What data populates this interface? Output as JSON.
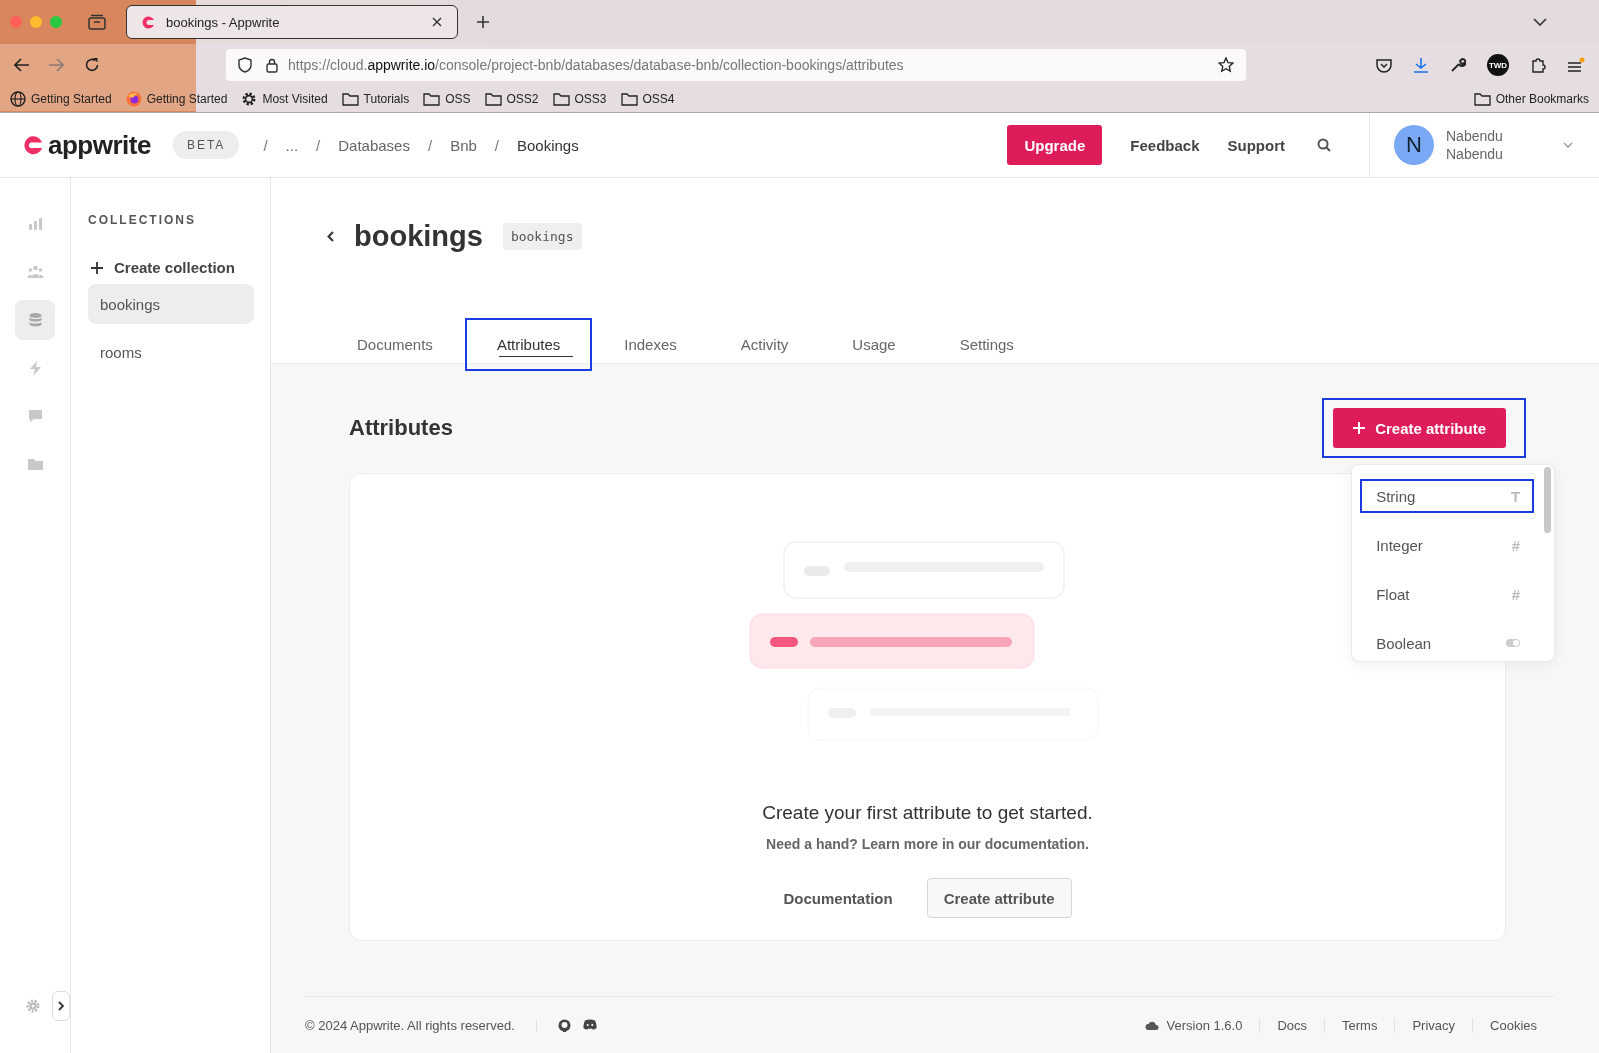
{
  "browser": {
    "tab_title": "bookings - Appwrite",
    "url_prefix": "https://cloud.",
    "url_domain": "appwrite.io",
    "url_path": "/console/project-bnb/databases/database-bnb/collection-bookings/attributes",
    "bookmarks": [
      {
        "label": "Getting Started",
        "kind": "globe"
      },
      {
        "label": "Getting Started",
        "kind": "firefox"
      },
      {
        "label": "Most Visited",
        "kind": "gear"
      },
      {
        "label": "Tutorials",
        "kind": "folder"
      },
      {
        "label": "OSS",
        "kind": "folder"
      },
      {
        "label": "OSS2",
        "kind": "folder"
      },
      {
        "label": "OSS3",
        "kind": "folder"
      },
      {
        "label": "OSS4",
        "kind": "folder"
      }
    ],
    "other_bookmarks": "Other Bookmarks",
    "avatar_text": "TWD"
  },
  "header": {
    "logo": "appwrite",
    "badge": "BETA",
    "separator": "/",
    "breadcrumbs": [
      "...",
      "Databases",
      "Bnb",
      "Bookings"
    ],
    "upgrade": "Upgrade",
    "links": [
      "Feedback",
      "Support"
    ],
    "user": {
      "initial": "N",
      "name": "Nabendu",
      "org": "Nabendu"
    }
  },
  "rail": [
    {
      "kind": "chart",
      "selected": false
    },
    {
      "kind": "people",
      "selected": false
    },
    {
      "kind": "database",
      "selected": true
    },
    {
      "kind": "bolt",
      "selected": false
    },
    {
      "kind": "chat",
      "selected": false
    },
    {
      "kind": "folder",
      "selected": false
    }
  ],
  "collections": {
    "heading": "COLLECTIONS",
    "create": "Create collection",
    "items": [
      {
        "label": "bookings",
        "selected": true
      },
      {
        "label": "rooms",
        "selected": false
      }
    ]
  },
  "page": {
    "title": "bookings",
    "id_badge": "bookings",
    "tabs": [
      {
        "label": "Documents",
        "selected": false,
        "highlighted": false
      },
      {
        "label": "Attributes",
        "selected": true,
        "highlighted": true
      },
      {
        "label": "Indexes",
        "selected": false,
        "highlighted": false
      },
      {
        "label": "Activity",
        "selected": false,
        "highlighted": false
      },
      {
        "label": "Usage",
        "selected": false,
        "highlighted": false
      },
      {
        "label": "Settings",
        "selected": false,
        "highlighted": false
      }
    ],
    "section_title": "Attributes",
    "create_button": {
      "label": "Create attribute",
      "highlighted": true
    },
    "menu": [
      {
        "label": "String",
        "kind": "text",
        "symbol": "T",
        "highlighted": true
      },
      {
        "label": "Integer",
        "kind": "text",
        "symbol": "#",
        "highlighted": false
      },
      {
        "label": "Float",
        "kind": "text",
        "symbol": "#",
        "highlighted": false
      },
      {
        "label": "Boolean",
        "kind": "toggle",
        "highlighted": false
      }
    ],
    "empty": {
      "title": "Create your first attribute to get started.",
      "text": "Need a hand? Learn more in our documentation.",
      "secondary": "Documentation",
      "primary": "Create attribute"
    }
  },
  "footer": {
    "copyright": "© 2024 Appwrite. All rights reserved.",
    "version": "Version 1.6.0",
    "links": [
      "Docs",
      "Terms",
      "Privacy",
      "Cookies"
    ]
  }
}
